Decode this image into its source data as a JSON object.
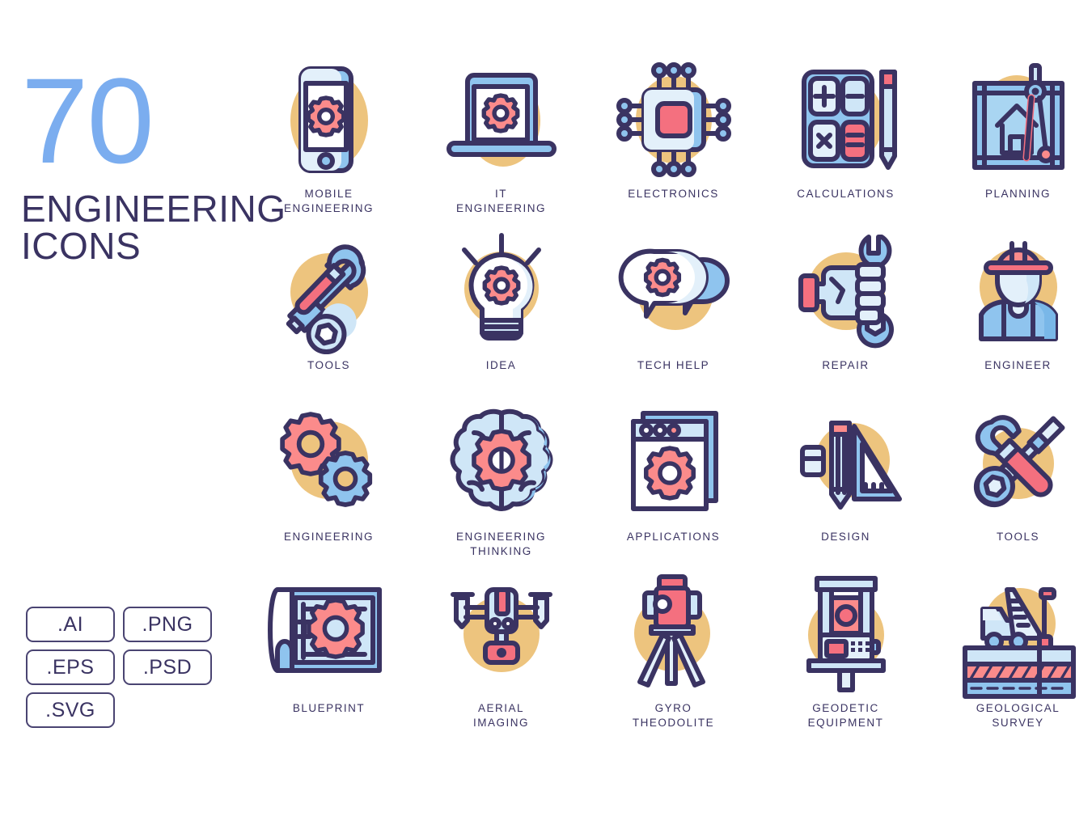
{
  "title": {
    "count": "70",
    "line1": "ENGINEERING",
    "line2": "ICONS"
  },
  "colors": {
    "blue_accent": "#7BADEF",
    "navy_text": "#3A3362",
    "tan_circle": "#EDC47E",
    "pink": "#FB8B8B",
    "pink_dark": "#F4707F",
    "light_blue": "#CFE6F7",
    "mid_blue": "#8FC4EE",
    "pale_blue": "#E3F0FA",
    "white": "#FFFFFF"
  },
  "formats": [
    {
      "label": ".AI"
    },
    {
      "label": ".PNG"
    },
    {
      "label": ".EPS"
    },
    {
      "label": ".PSD"
    },
    {
      "label": ".SVG"
    }
  ],
  "icons": [
    {
      "id": "mobile-engineering",
      "label": "MOBILE\nENGINEERING"
    },
    {
      "id": "it-engineering",
      "label": "IT\nENGINEERING"
    },
    {
      "id": "electronics",
      "label": "ELECTRONICS"
    },
    {
      "id": "calculations",
      "label": "CALCULATIONS"
    },
    {
      "id": "planning",
      "label": "PLANNING"
    },
    {
      "id": "tools-hammer",
      "label": "TOOLS"
    },
    {
      "id": "idea",
      "label": "IDEA"
    },
    {
      "id": "tech-help",
      "label": "TECH HELP"
    },
    {
      "id": "repair",
      "label": "REPAIR"
    },
    {
      "id": "engineer",
      "label": "ENGINEER"
    },
    {
      "id": "engineering",
      "label": "ENGINEERING"
    },
    {
      "id": "engineering-thinking",
      "label": "ENGINEERING\nTHINKING"
    },
    {
      "id": "applications",
      "label": "APPLICATIONS"
    },
    {
      "id": "design",
      "label": "DESIGN"
    },
    {
      "id": "tools-screwdriver",
      "label": "TOOLS"
    },
    {
      "id": "blueprint",
      "label": "BLUEPRINT"
    },
    {
      "id": "aerial-imaging",
      "label": "AERIAL\nIMAGING"
    },
    {
      "id": "gyro-theodolite",
      "label": "GYRO\nTHEODOLITE"
    },
    {
      "id": "geodetic-equipment",
      "label": "GEODETIC\nEQUIPMENT"
    },
    {
      "id": "geological-survey",
      "label": "GEOLOGICAL\nSURVEY"
    }
  ]
}
